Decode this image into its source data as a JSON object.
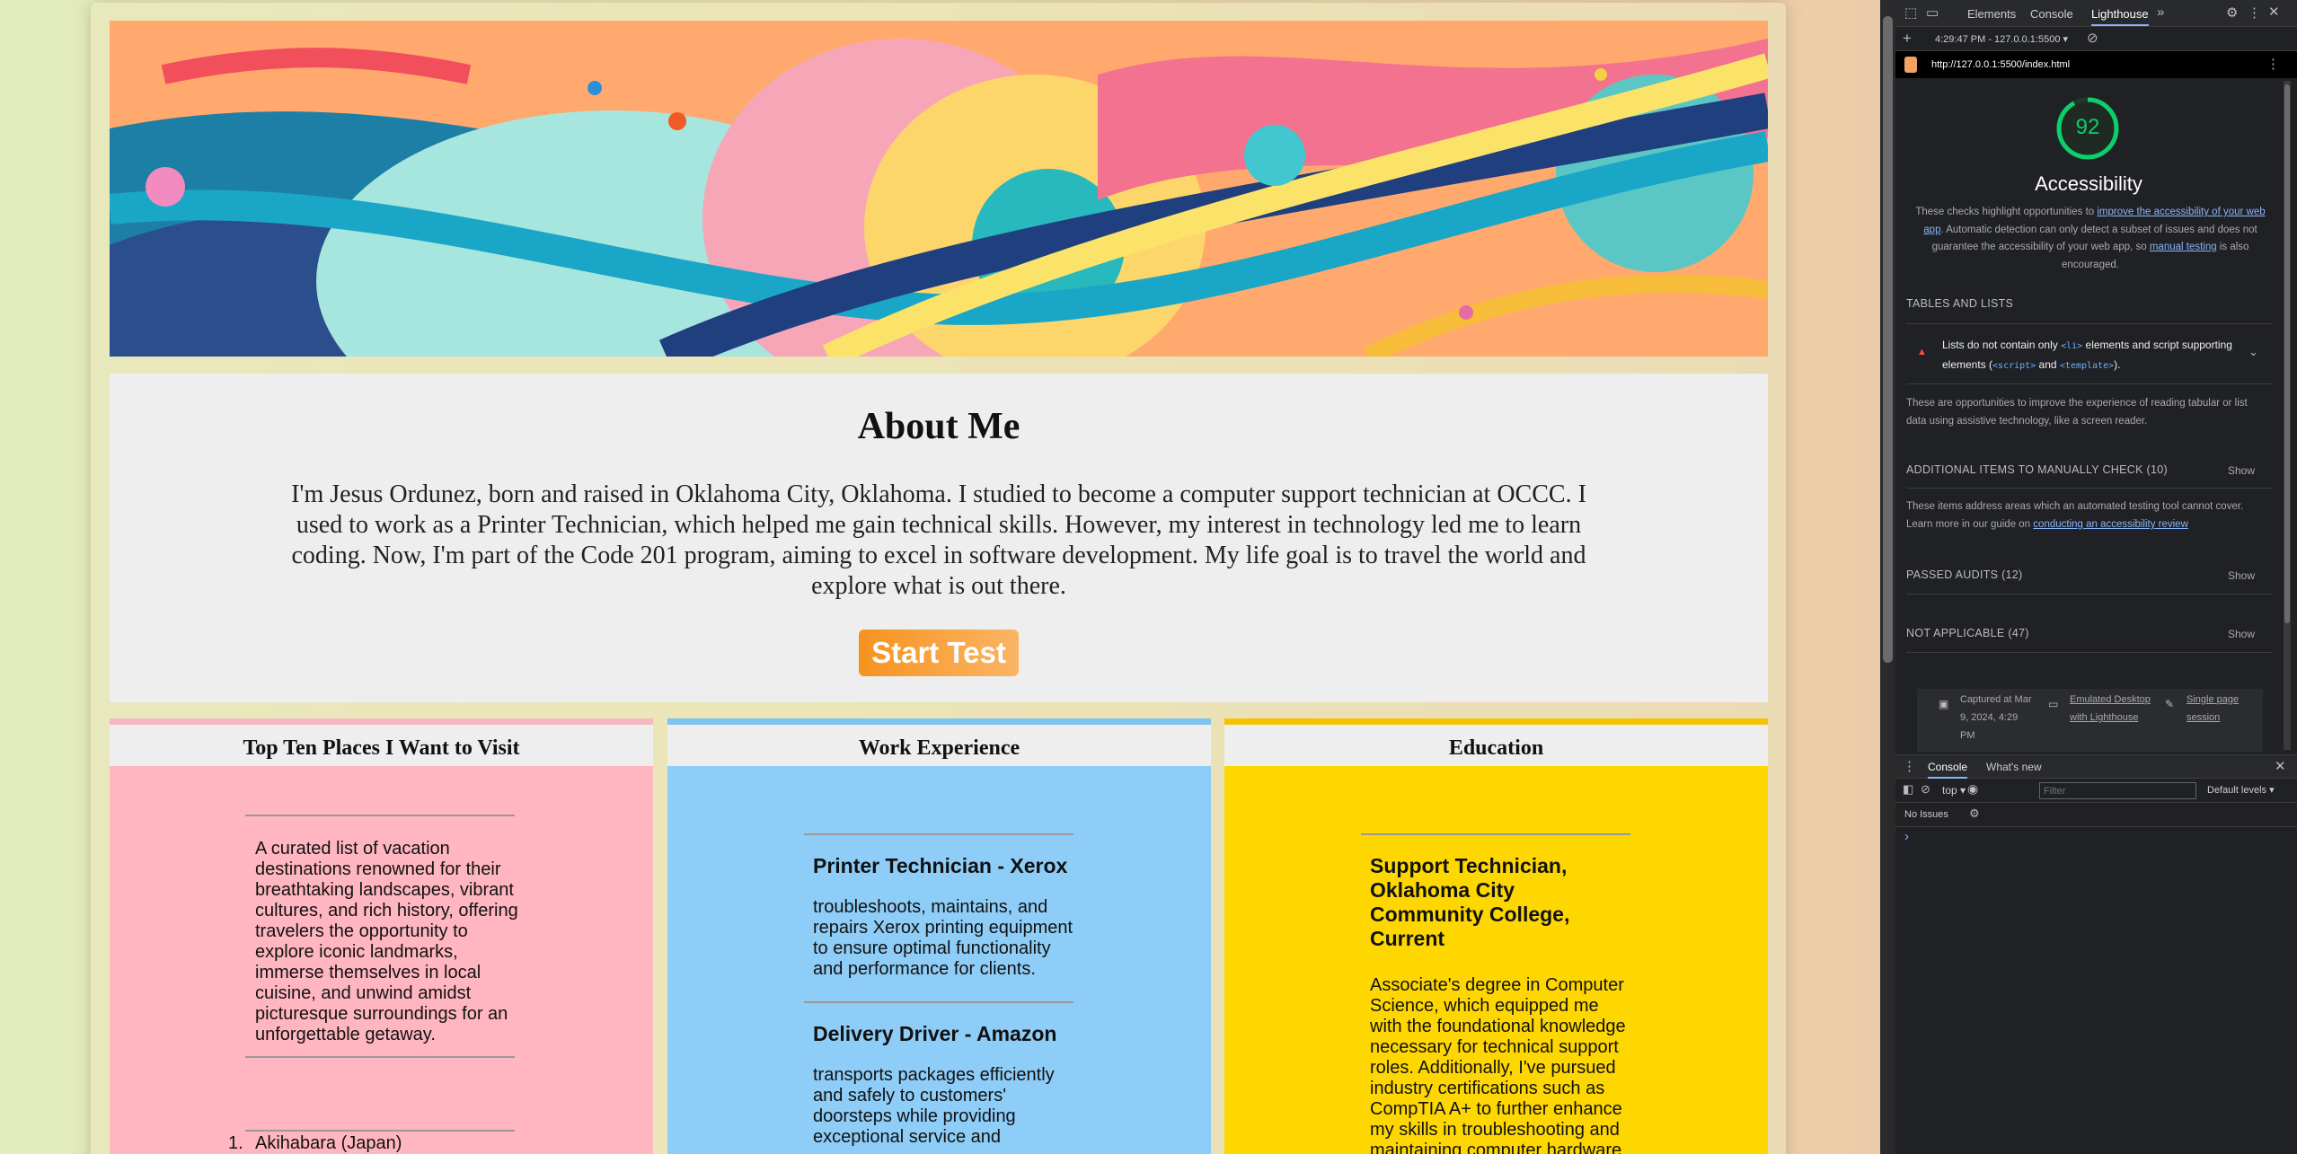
{
  "about": {
    "title": "About Me",
    "text": "I'm Jesus Ordunez, born and raised in Oklahoma City, Oklahoma. I studied to become a computer support technician at OCCC. I used to work as a Printer Technician, which helped me gain technical skills. However, my interest in technology led me to learn coding. Now, I'm part of the Code 201 program, aiming to excel in software development. My life goal is to travel the world and explore what is out there.",
    "button": "Start Test"
  },
  "cards": {
    "places": {
      "title": "Top Ten Places I Want to Visit",
      "description": "A curated list of vacation destinations renowned for their breathtaking landscapes, vibrant cultures, and rich history, offering travelers the opportunity to explore iconic landmarks, immerse themselves in local cuisine, and unwind amidst picturesque surroundings for an unforgettable getaway.",
      "first_item_number": "1.",
      "first_item": "Akihabara (Japan)"
    },
    "work": {
      "title": "Work Experience",
      "job1_title": "Printer Technician - Xerox",
      "job1_text": "troubleshoots, maintains, and repairs Xerox printing equipment to ensure optimal functionality and performance for clients.",
      "job2_title": "Delivery Driver - Amazon",
      "job2_text": "transports packages efficiently and safely to customers' doorsteps while providing exceptional service and"
    },
    "education": {
      "title": "Education",
      "school_title": "Support Technician, Oklahoma City Community College, Current",
      "school_text": "Associate's degree in Computer Science, which equipped me with the foundational knowledge necessary for technical support roles. Additionally, I've pursued industry certifications such as CompTIA A+ to further enhance my skills in troubleshooting and maintaining computer hardware"
    }
  },
  "devtools": {
    "tabs": [
      "Elements",
      "Console",
      "Lighthouse"
    ],
    "active_tab": "Lighthouse",
    "report_selector": "4:29:47 PM - 127.0.0.1:5500 ▾",
    "url": "http://127.0.0.1:5500/index.html",
    "score": "92",
    "score_fraction": 0.92,
    "category": "Accessibility",
    "desc_part1": "These checks highlight opportunities to ",
    "desc_link1": "improve the accessibility of your web app",
    "desc_part2": ". Automatic detection can only detect a subset of issues and does not guarantee the accessibility of your web app, so ",
    "desc_link2": "manual testing",
    "desc_part3": " is also encouraged.",
    "tables_heading": "TABLES AND LISTS",
    "audit_part1": "Lists do not contain only ",
    "audit_code1": "<li>",
    "audit_part2": " elements and script supporting elements (",
    "audit_code2": "<script>",
    "audit_part3": " and ",
    "audit_code3": "<template>",
    "audit_part4": ").",
    "tables_note": "These are opportunities to improve the experience of reading tabular or list data using assistive technology, like a screen reader.",
    "manual_heading": "ADDITIONAL ITEMS TO MANUALLY CHECK (10)",
    "manual_note_part1": "These items address areas which an automated testing tool cannot cover. Learn more in our guide on ",
    "manual_note_link": "conducting an accessibility review",
    "passed_heading": "PASSED AUDITS (12)",
    "na_heading": "NOT APPLICABLE (47)",
    "show": "Show",
    "captured": "Captured at Mar 9, 2024, 4:29 PM",
    "emulated": "Emulated Desktop with Lighthouse",
    "session": "Single page session",
    "console_tab": "Console",
    "whats_new_tab": "What's new",
    "context": "top",
    "filter_placeholder": "Filter",
    "levels": "Default levels ▾",
    "no_issues": "No Issues",
    "prompt": "›",
    "colors": {
      "pass": "#0cce6b",
      "panel": "#202124"
    }
  }
}
